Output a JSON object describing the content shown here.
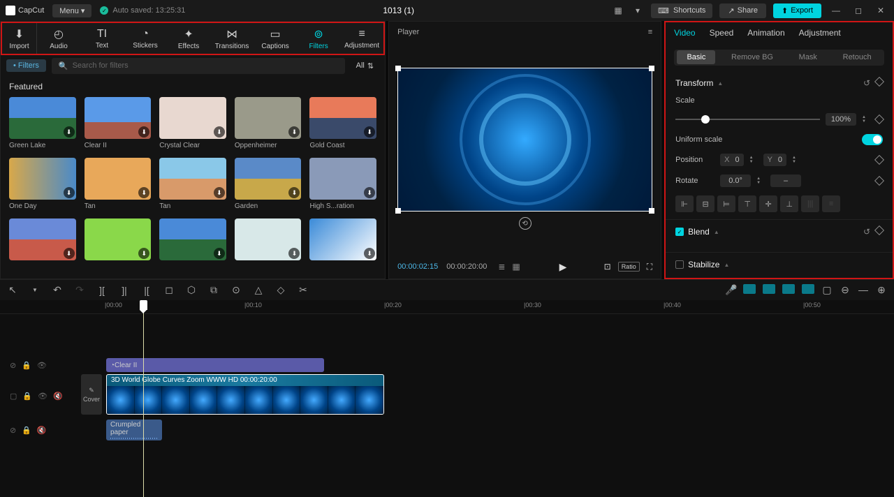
{
  "titlebar": {
    "app_name": "CapCut",
    "menu": "Menu",
    "autosave": "Auto saved: 13:25:31",
    "project_title": "1013 (1)",
    "shortcuts": "Shortcuts",
    "share": "Share",
    "export": "Export"
  },
  "toolbar": {
    "import": "Import",
    "items": [
      "Audio",
      "Text",
      "Stickers",
      "Effects",
      "Transitions",
      "Captions",
      "Filters",
      "Adjustment"
    ],
    "active": "Filters"
  },
  "filters_panel": {
    "tag": "Filters",
    "search_placeholder": "Search for filters",
    "all": "All",
    "featured": "Featured",
    "thumbs": [
      {
        "label": "Green Lake",
        "bg": "linear-gradient(180deg,#4a8ad8 50%,#2a6a3a 50%)"
      },
      {
        "label": "Clear II",
        "bg": "linear-gradient(180deg,#5a9ae8 60%,#a85a4a 60%)"
      },
      {
        "label": "Crystal Clear",
        "bg": "#e8d8d0"
      },
      {
        "label": "Oppenheimer",
        "bg": "#9a9a8a"
      },
      {
        "label": "Gold Coast",
        "bg": "linear-gradient(180deg,#e87a5a 50%,#3a4a6a 50%)"
      },
      {
        "label": "One Day",
        "bg": "linear-gradient(90deg,#d8a84a,#4a8ac8)"
      },
      {
        "label": "Tan",
        "bg": "#e8a85a"
      },
      {
        "label": "Tan",
        "bg": "linear-gradient(180deg,#8ac8e8 50%,#d89a6a 50%)"
      },
      {
        "label": "Garden",
        "bg": "linear-gradient(180deg,#5a8ac8 50%,#c8a84a 50%)"
      },
      {
        "label": "High S...ration",
        "bg": "#8a9ab8"
      },
      {
        "label": "",
        "bg": "linear-gradient(180deg,#6a8ad8 50%,#c85a4a 50%)"
      },
      {
        "label": "",
        "bg": "#8ad84a"
      },
      {
        "label": "",
        "bg": "linear-gradient(180deg,#4a8ad8 50%,#2a6a3a 50%)"
      },
      {
        "label": "",
        "bg": "#d8e8e8"
      },
      {
        "label": "",
        "bg": "linear-gradient(135deg,#3a8ad8,#fff)"
      }
    ]
  },
  "player": {
    "title": "Player",
    "time_current": "00:00:02:15",
    "time_duration": "00:00:20:00",
    "ratio": "Ratio"
  },
  "properties": {
    "tabs": [
      "Video",
      "Speed",
      "Animation",
      "Adjustment"
    ],
    "active_tab": "Video",
    "sub_tabs": [
      "Basic",
      "Remove BG",
      "Mask",
      "Retouch"
    ],
    "active_sub": "Basic",
    "transform": "Transform",
    "scale": "Scale",
    "scale_value": "100%",
    "uniform": "Uniform scale",
    "position": "Position",
    "pos_x": "0",
    "pos_y": "0",
    "rotate": "Rotate",
    "rotate_value": "0.0°",
    "blend": "Blend",
    "stabilize": "Stabilize"
  },
  "timeline": {
    "ticks": [
      "|00:00",
      "|00:10",
      "|00:20",
      "|00:30",
      "|00:40",
      "|00:50"
    ],
    "cover": "Cover",
    "filter_clip": "Clear II",
    "video_clip": "3D World Globe Curves Zoom WWW HD   00:00:20:00",
    "audio_clip": "Crumpled paper"
  }
}
